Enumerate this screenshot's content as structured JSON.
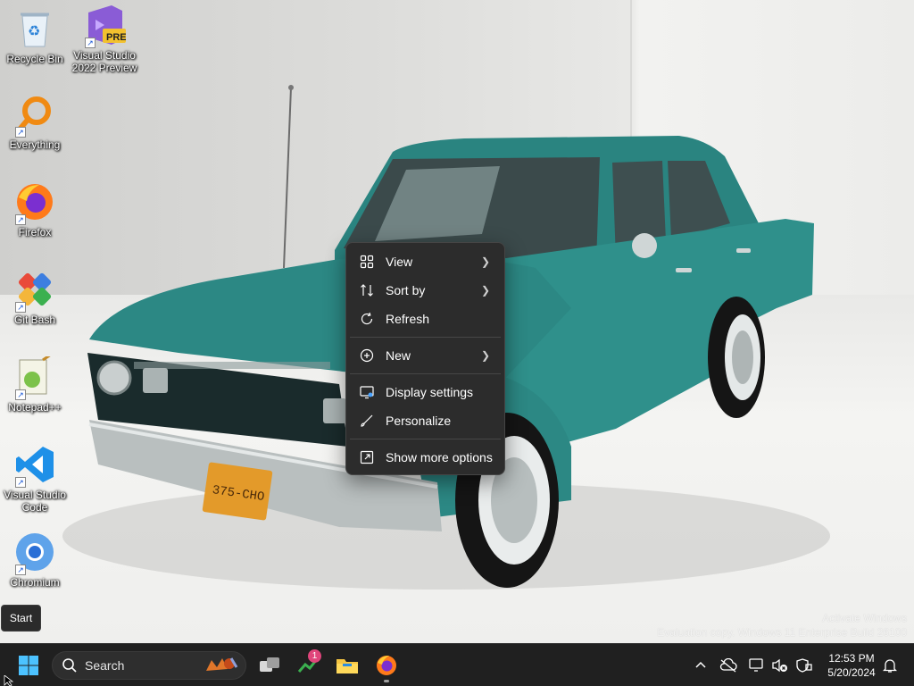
{
  "desktop": {
    "icons": [
      {
        "label": "Recycle Bin",
        "icon": "recycle-bin-icon"
      },
      {
        "label": "Visual Studio\n2022 Preview",
        "icon": "visual-studio-preview-icon",
        "badge": "PRE"
      },
      {
        "label": "Everything",
        "icon": "everything-search-icon"
      },
      {
        "label": "Firefox",
        "icon": "firefox-icon"
      },
      {
        "label": "Git Bash",
        "icon": "git-bash-icon"
      },
      {
        "label": "Notepad++",
        "icon": "notepad-plus-plus-icon"
      },
      {
        "label": "Visual Studio\nCode",
        "icon": "vscode-icon"
      },
      {
        "label": "Chromium",
        "icon": "chromium-icon"
      }
    ]
  },
  "wallpaper": {
    "plate": "375-CHO"
  },
  "context_menu": {
    "items": [
      {
        "label": "View",
        "icon": "grid-view-icon",
        "submenu": true
      },
      {
        "label": "Sort by",
        "icon": "sort-icon",
        "submenu": true
      },
      {
        "label": "Refresh",
        "icon": "refresh-icon",
        "submenu": false
      },
      {
        "label": "New",
        "icon": "new-plus-icon",
        "submenu": true
      },
      {
        "label": "Display settings",
        "icon": "display-settings-icon",
        "submenu": false
      },
      {
        "label": "Personalize",
        "icon": "personalize-brush-icon",
        "submenu": false
      },
      {
        "label": "Show more options",
        "icon": "show-more-options-icon",
        "submenu": false
      }
    ]
  },
  "tooltip": {
    "text": "Start"
  },
  "watermark": {
    "line1": "Activate Windows",
    "line2": "Evaluation copy. Windows 11 Enterprise Build 26100"
  },
  "taskbar": {
    "search_placeholder": "Search",
    "task_badge": "1",
    "clock_time": "12:53 PM",
    "clock_date": "5/20/2024"
  },
  "colors": {
    "taskbar_bg": "#202020",
    "menu_bg": "#2c2c2c",
    "car_teal": "#2c8a86",
    "windows_blue": "#1e90e8"
  }
}
